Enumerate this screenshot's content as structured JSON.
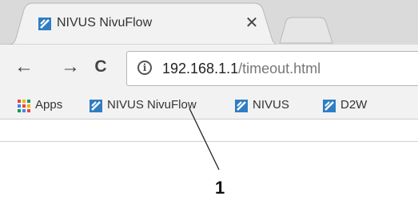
{
  "tab": {
    "title": "NIVUS NivuFlow",
    "close_glyph": "✕",
    "favicon": "nivus-favicon"
  },
  "toolbar": {
    "back_glyph": "←",
    "forward_glyph": "→",
    "reload_glyph": "C",
    "info_glyph": "i",
    "url_host": "192.168.1.1",
    "url_path": "/timeout.html"
  },
  "bookmarks": [
    {
      "label": "Apps",
      "icon": "apps-grid-icon"
    },
    {
      "label": "NIVUS NivuFlow",
      "icon": "nivus-favicon"
    },
    {
      "label": "NIVUS",
      "icon": "nivus-favicon"
    },
    {
      "label": "D2W",
      "icon": "nivus-favicon"
    }
  ],
  "callout": {
    "label": "1"
  },
  "colors": {
    "favicon_blue": "#2f7dc3",
    "chrome_gray": "#dadada",
    "toolbar_gray": "#f2f2f2"
  }
}
